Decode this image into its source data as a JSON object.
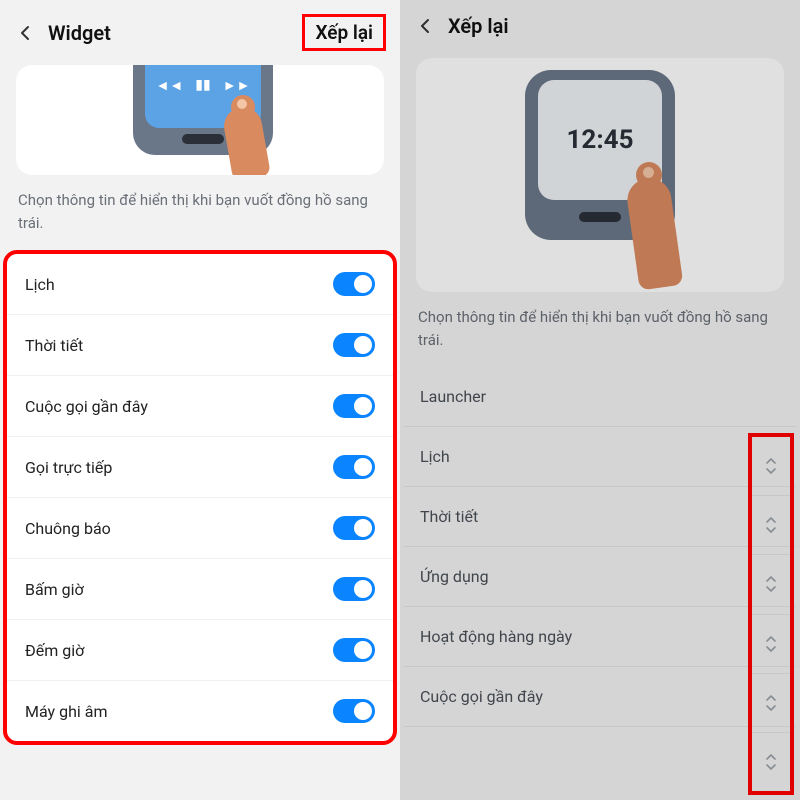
{
  "left": {
    "header": {
      "title": "Widget",
      "action": "Xếp lại"
    },
    "description": "Chọn thông tin để hiển thị khi bạn vuốt đồng hồ sang trái.",
    "toggles": [
      {
        "label": "Lịch"
      },
      {
        "label": "Thời tiết"
      },
      {
        "label": "Cuộc gọi gần đây"
      },
      {
        "label": "Gọi trực tiếp"
      },
      {
        "label": "Chuông báo"
      },
      {
        "label": "Bấm giờ"
      },
      {
        "label": "Đếm giờ"
      },
      {
        "label": "Máy ghi âm"
      }
    ]
  },
  "right": {
    "header": {
      "title": "Xếp lại"
    },
    "clock_time": "12:45",
    "description": "Chọn thông tin để hiển thị khi bạn vuốt đồng hồ sang trái.",
    "items": [
      {
        "label": "Launcher"
      },
      {
        "label": "Lịch"
      },
      {
        "label": "Thời tiết"
      },
      {
        "label": "Ứng dụng"
      },
      {
        "label": "Hoạt động hàng ngày"
      },
      {
        "label": "Cuộc gọi gần đây"
      }
    ]
  }
}
